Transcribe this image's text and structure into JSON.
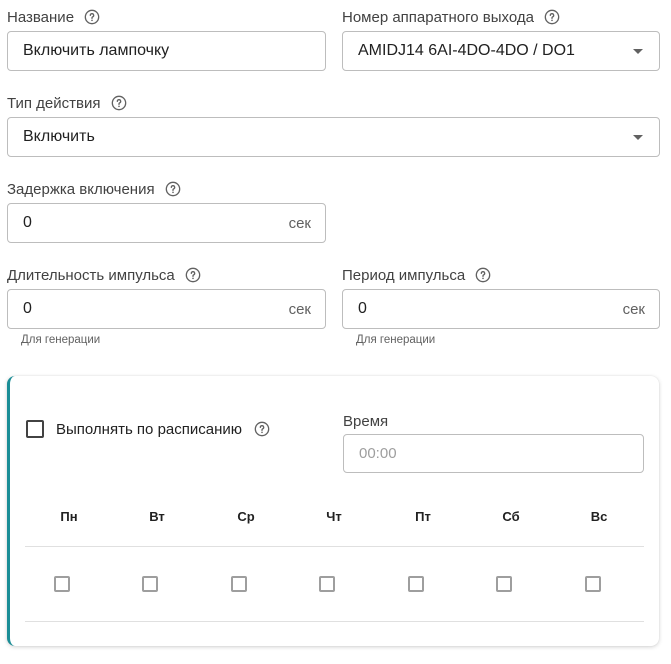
{
  "name": {
    "label": "Название",
    "value": "Включить лампочку"
  },
  "output": {
    "label": "Номер аппаратного выхода",
    "value": "AMIDJ14 6AI-4DO-4DO / DO1"
  },
  "action": {
    "label": "Тип действия",
    "value": "Включить"
  },
  "delay": {
    "label": "Задержка включения",
    "value": "0",
    "unit": "сек"
  },
  "pulse_duration": {
    "label": "Длительность импульса",
    "value": "0",
    "unit": "сек",
    "hint": "Для генерации"
  },
  "pulse_period": {
    "label": "Период импульса",
    "value": "0",
    "unit": "сек",
    "hint": "Для генерации"
  },
  "schedule": {
    "checkbox_label": "Выполнять по расписанию",
    "checked": false,
    "time_label": "Время",
    "time_placeholder": "00:00",
    "days": [
      "Пн",
      "Вт",
      "Ср",
      "Чт",
      "Пт",
      "Сб",
      "Вс"
    ]
  },
  "colors": {
    "accent": "#1a8d96",
    "border": "#bdbdbd"
  },
  "icons": {
    "help": "help-circle-icon",
    "dropdown": "caret-down-icon"
  }
}
